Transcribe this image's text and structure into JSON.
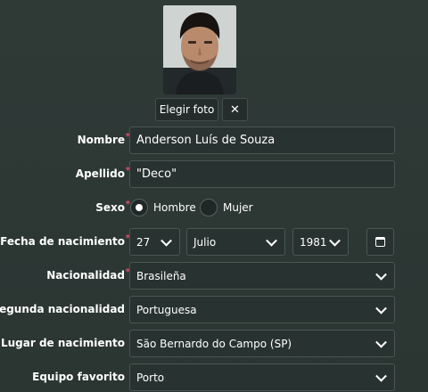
{
  "photo": {
    "alt": "player-photo"
  },
  "buttons": {
    "choose_photo": "Elegir foto",
    "remove_photo": "✕"
  },
  "form": {
    "nombre": {
      "label": "Nombre",
      "value": "Anderson Luís de Souza",
      "required": true
    },
    "apellido": {
      "label": "Apellido",
      "value": "\"Deco\"",
      "required": true
    },
    "sexo": {
      "label": "Sexo",
      "required": true,
      "options": [
        "Hombre",
        "Mujer"
      ],
      "selected": "Hombre"
    },
    "fecha": {
      "label": "Fecha de nacimiento",
      "required": true,
      "day": "27",
      "month": "Julio",
      "year": "1981"
    },
    "nacionalidad": {
      "label": "Nacionalidad",
      "value": "Brasileña",
      "required": true
    },
    "segunda": {
      "label": "Segunda nacionalidad",
      "value": "Portuguesa"
    },
    "lugar": {
      "label": "Lugar de nacimiento",
      "value": "São Bernardo do Campo (SP)"
    },
    "equipo": {
      "label": "Equipo favorito",
      "value": "Porto"
    }
  },
  "colors": {
    "background": "#2e3936",
    "required_marker": "#e0506a",
    "field_bg": "#283230",
    "field_border": "#4b5653"
  },
  "icons": {
    "dropdown": "chevron-down-icon",
    "calendar": "calendar-icon",
    "close": "close-icon"
  }
}
